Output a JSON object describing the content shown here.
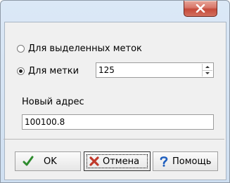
{
  "dialog": {
    "close_glyph": "×",
    "option_selected": "Для выделенных меток",
    "option_single": "Для метки",
    "mark_value": "125",
    "address_label": "Новый адрес",
    "address_value": "100100.8"
  },
  "buttons": {
    "ok": "OK",
    "cancel": "Отмена",
    "help": "Помощь"
  },
  "colors": {
    "ok_check": "#2e8b2e",
    "cancel_x": "#c0392b",
    "help_q": "#1f5fbf"
  }
}
